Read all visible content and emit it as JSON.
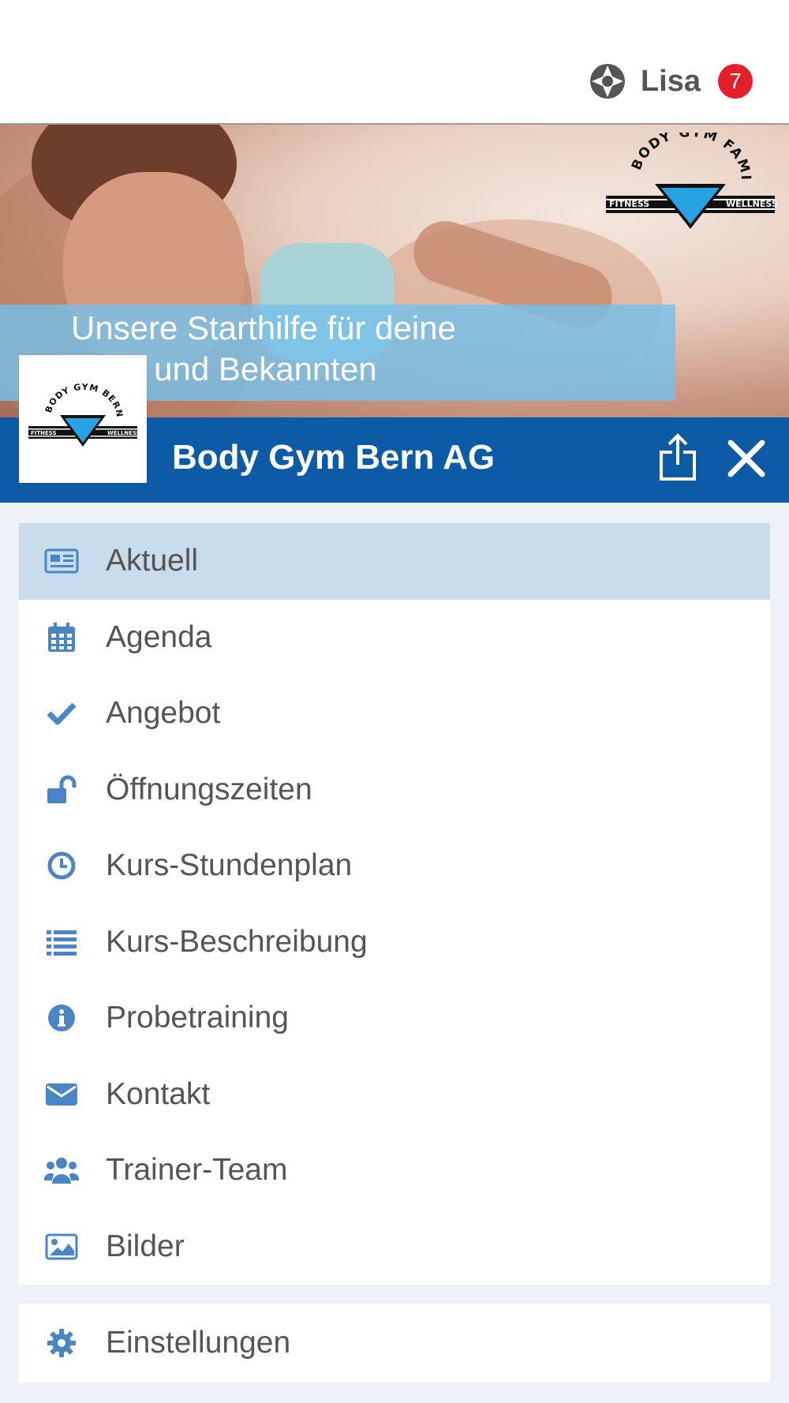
{
  "user": {
    "name": "Lisa",
    "badge_count": "7",
    "logo_icon": "brand-logo-icon"
  },
  "banner": {
    "caption_line1": "Unsere Starthilfe für deine",
    "caption_line2": "unde und Bekannten",
    "logo": "body-gym-family-logo"
  },
  "header": {
    "title": "Body Gym Bern AG",
    "color": "#0d5aa7"
  },
  "menu": {
    "items": [
      {
        "label": "Aktuell",
        "icon": "newspaper-icon",
        "active": true
      },
      {
        "label": "Agenda",
        "icon": "calendar-icon"
      },
      {
        "label": "Angebot",
        "icon": "check-icon"
      },
      {
        "label": "Öffnungszeiten",
        "icon": "unlock-icon"
      },
      {
        "label": "Kurs-Stundenplan",
        "icon": "clock-icon"
      },
      {
        "label": "Kurs-Beschreibung",
        "icon": "list-icon"
      },
      {
        "label": "Probetraining",
        "icon": "info-icon"
      },
      {
        "label": "Kontakt",
        "icon": "envelope-icon"
      },
      {
        "label": "Trainer-Team",
        "icon": "users-icon"
      },
      {
        "label": "Bilder",
        "icon": "image-icon"
      }
    ],
    "settings_label": "Einstellungen"
  },
  "colors": {
    "accent": "#4a86c5",
    "active_bg": "#c9dcec",
    "badge": "#e3202a"
  }
}
